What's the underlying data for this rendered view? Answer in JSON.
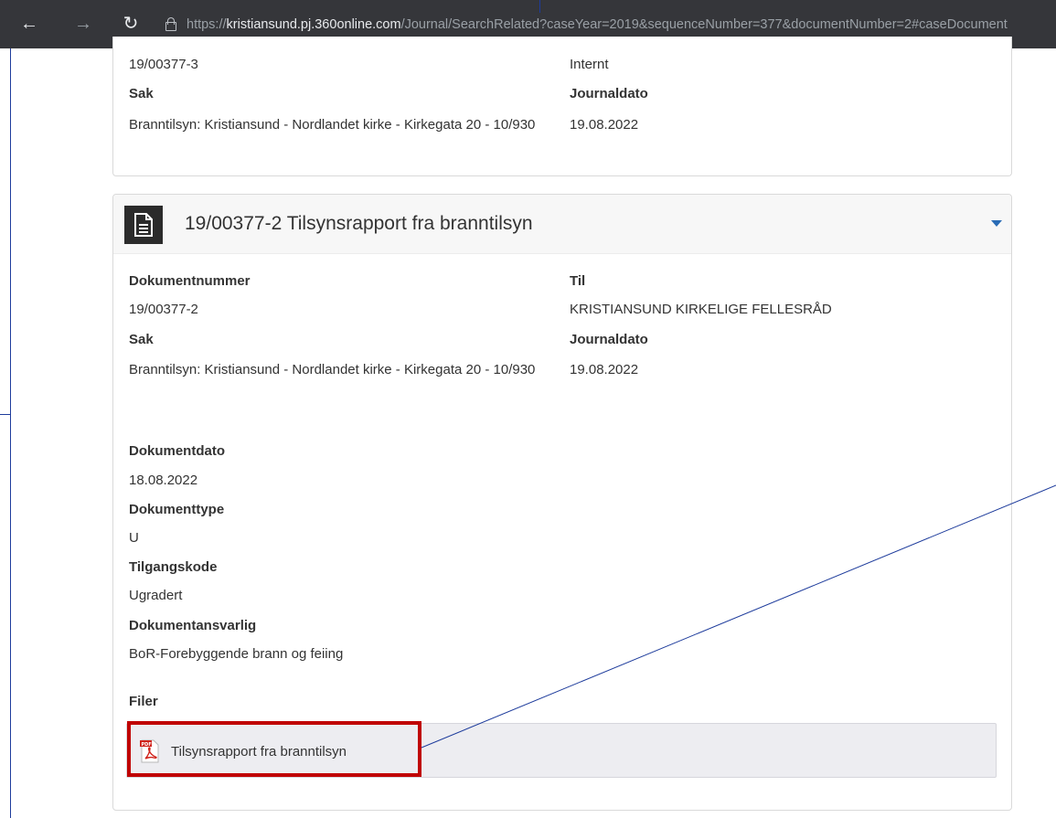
{
  "browser": {
    "url_prefix": "https://",
    "url_host": "kristiansund.pj.360online.com",
    "url_rest": "/Journal/SearchRelated?caseYear=2019&sequenceNumber=377&documentNumber=2#caseDocument"
  },
  "previous_card": {
    "doc_number_value": "19/00377-3",
    "to_value": "Internt",
    "sak_label": "Sak",
    "sak_value": "Branntilsyn: Kristiansund - Nordlandet kirke - Kirkegata 20 - 10/930",
    "journaldato_label": "Journaldato",
    "journaldato_value": "19.08.2022"
  },
  "document_card": {
    "title": "19/00377-2 Tilsynsrapport fra branntilsyn",
    "dokumentnummer_label": "Dokumentnummer",
    "dokumentnummer_value": "19/00377-2",
    "til_label": "Til",
    "til_value": "KRISTIANSUND KIRKELIGE FELLESRÅD",
    "sak_label": "Sak",
    "sak_value": "Branntilsyn: Kristiansund - Nordlandet kirke - Kirkegata 20 - 10/930",
    "journaldato_label": "Journaldato",
    "journaldato_value": "19.08.2022",
    "dokumentdato_label": "Dokumentdato",
    "dokumentdato_value": "18.08.2022",
    "dokumenttype_label": "Dokumenttype",
    "dokumenttype_value": "U",
    "tilgangskode_label": "Tilgangskode",
    "tilgangskode_value": "Ugradert",
    "dokumentansvarlig_label": "Dokumentansvarlig",
    "dokumentansvarlig_value": "BoR-Forebyggende brann og feiing",
    "filer_label": "Filer",
    "files": [
      {
        "name": "Tilsynsrapport fra branntilsyn",
        "icon": "pdf-icon"
      }
    ]
  },
  "colors": {
    "highlight": "#c00000",
    "annotation_line": "#1e3c9c",
    "caret": "#2a6cb6"
  }
}
